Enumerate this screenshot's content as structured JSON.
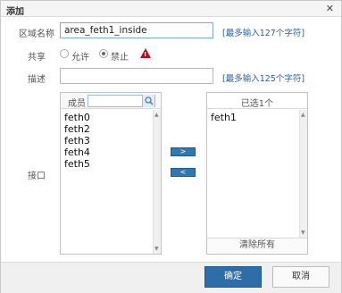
{
  "dialog": {
    "title": "添加",
    "close_glyph": "✕"
  },
  "form": {
    "name_label": "区域名称",
    "name_value": "area_feth1_inside",
    "name_hint": "[最多输入127个字符]",
    "share_label": "共享",
    "share_options": [
      {
        "label": "允许",
        "checked": false
      },
      {
        "label": "禁止",
        "checked": true
      }
    ],
    "warning_icon": "warning-icon",
    "desc_label": "描述",
    "desc_value": "",
    "desc_hint": "[最多输入125个字符]",
    "iface_label": "接口"
  },
  "members": {
    "header": "成员",
    "search_value": "",
    "items": [
      "feth0",
      "feth2",
      "feth3",
      "feth4",
      "feth5"
    ]
  },
  "selected": {
    "header": "已选1个",
    "items": [
      "feth1"
    ],
    "clear_label": "清除所有"
  },
  "move": {
    "add_label": ">",
    "remove_label": "<"
  },
  "footer": {
    "ok_label": "确定",
    "cancel_label": "取消"
  },
  "colors": {
    "primary": "#2d6ea8",
    "link_hint": "#2a5f9e",
    "warning": "#d0021b"
  }
}
